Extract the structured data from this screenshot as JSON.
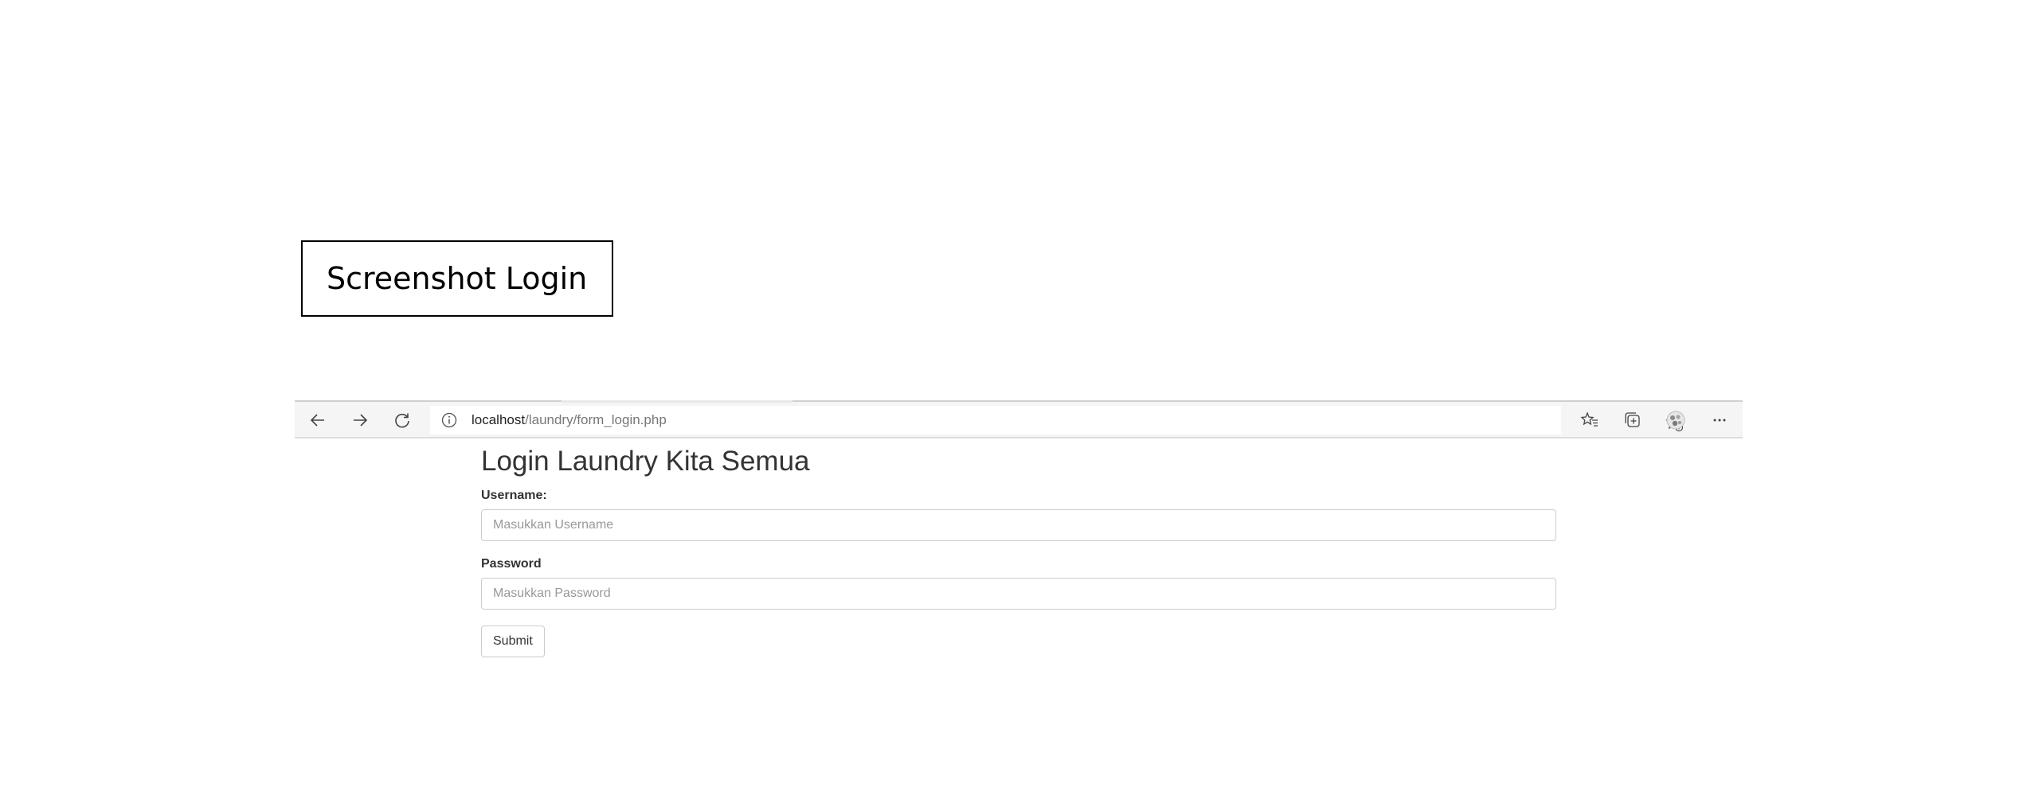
{
  "caption": {
    "text": "Screenshot Login"
  },
  "browser": {
    "url_host": "localhost",
    "url_path": "/laundry/form_login.php",
    "icons": {
      "back": "back-arrow-icon",
      "forward": "forward-arrow-icon",
      "refresh": "refresh-icon",
      "site_info": "info-icon",
      "add_favorite": "add-favorite-icon",
      "favorites": "favorites-icon",
      "collections": "collections-icon",
      "profile": "profile-icon",
      "more": "more-icon"
    }
  },
  "form": {
    "title": "Login Laundry Kita Semua",
    "username_label": "Username:",
    "username_placeholder": "Masukkan Username",
    "password_label": "Password",
    "password_placeholder": "Masukkan Password",
    "submit_label": "Submit"
  },
  "colors": {
    "toolbar_bg": "#f5f5f5",
    "text": "#333333",
    "input_border": "#cccccc"
  }
}
